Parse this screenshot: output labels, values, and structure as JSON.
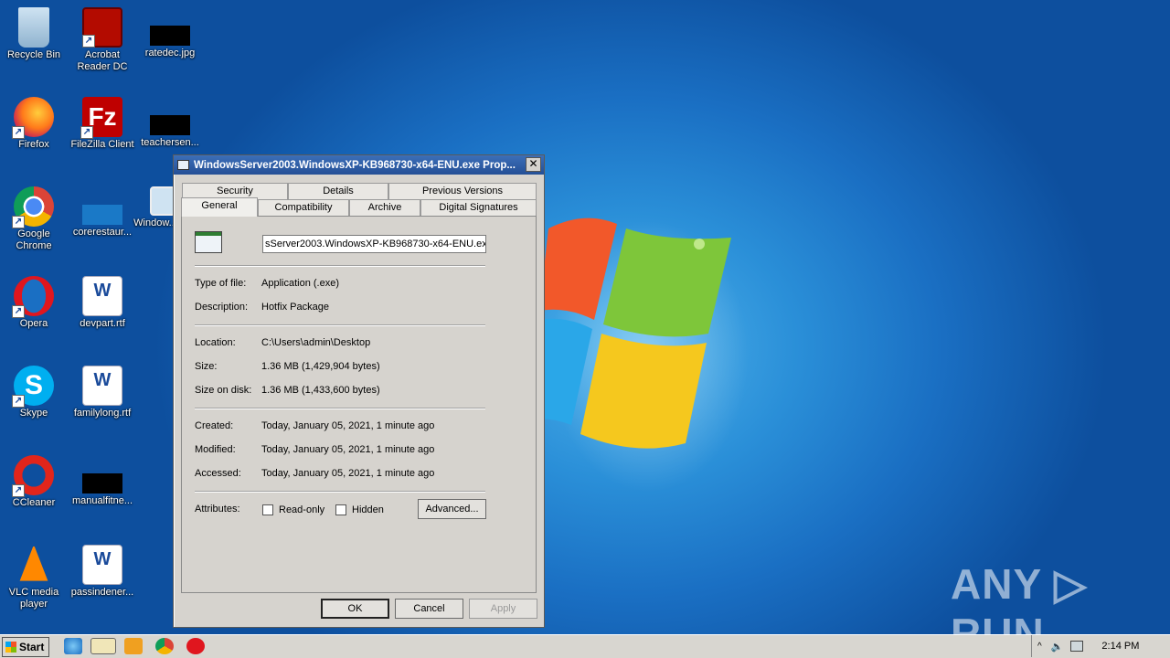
{
  "desktop": {
    "icons": [
      {
        "label": "Recycle Bin"
      },
      {
        "label": "Acrobat Reader DC"
      },
      {
        "label": "ratedec.jpg"
      },
      {
        "label": "Firefox"
      },
      {
        "label": "FileZilla Client"
      },
      {
        "label": "teachersen..."
      },
      {
        "label": "Google Chrome"
      },
      {
        "label": "corerestaur..."
      },
      {
        "label": "Window..."
      },
      {
        "label": "Opera"
      },
      {
        "label": "devpart.rtf"
      },
      {
        "label": "Skype"
      },
      {
        "label": "familylong.rtf"
      },
      {
        "label": "CCleaner"
      },
      {
        "label": "manualfitne..."
      },
      {
        "label": "VLC media player"
      },
      {
        "label": "passindener..."
      }
    ],
    "watermark": "ANY ▷ RUN"
  },
  "dialog": {
    "title": "WindowsServer2003.WindowsXP-KB968730-x64-ENU.exe Prop...",
    "close": "✕",
    "tabs_back": [
      "Security",
      "Details",
      "Previous Versions"
    ],
    "tabs_front": [
      "General",
      "Compatibility",
      "Archive",
      "Digital Signatures"
    ],
    "active_tab": "General",
    "file_name": "sServer2003.WindowsXP-KB968730-x64-ENU.exe",
    "type_label": "Type of file:",
    "type_value": "Application (.exe)",
    "desc_label": "Description:",
    "desc_value": "Hotfix Package",
    "location_label": "Location:",
    "location_value": "C:\\Users\\admin\\Desktop",
    "size_label": "Size:",
    "size_value": "1.36 MB (1,429,904 bytes)",
    "disk_label": "Size on disk:",
    "disk_value": "1.36 MB (1,433,600 bytes)",
    "created_label": "Created:",
    "created_value": "Today, January 05, 2021, 1 minute ago",
    "modified_label": "Modified:",
    "modified_value": "Today, January 05, 2021, 1 minute ago",
    "accessed_label": "Accessed:",
    "accessed_value": "Today, January 05, 2021, 1 minute ago",
    "attributes_label": "Attributes:",
    "readonly_label": "Read-only",
    "hidden_label": "Hidden",
    "advanced_label": "Advanced...",
    "ok_label": "OK",
    "cancel_label": "Cancel",
    "apply_label": "Apply"
  },
  "taskbar": {
    "start_label": "Start",
    "clock": "2:14 PM"
  }
}
